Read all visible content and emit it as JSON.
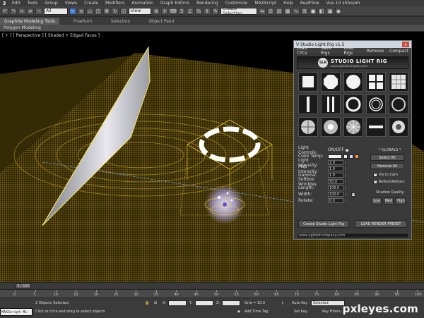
{
  "menubar": {
    "logo": "3",
    "items": [
      "Edit",
      "Tools",
      "Group",
      "Views",
      "Create",
      "Modifiers",
      "Animation",
      "Graph Editors",
      "Rendering",
      "Customize",
      "MAXScript",
      "Help",
      "RealFlow",
      "Vue 10 xStream"
    ]
  },
  "toolbar": {
    "selection_filter": "All",
    "reference_coord": "View",
    "named_selection": "Create Selection"
  },
  "ribbon": {
    "tabs": [
      "Graphite Modeling Tools",
      "Freeform",
      "Selection",
      "Object Paint"
    ],
    "panel": "Polygon Modeling"
  },
  "viewport": {
    "label": "[ + ] [ Perspective ] [ Shaded + Edged Faces ]"
  },
  "rig": {
    "title": "V Studio Light Rig v1.5",
    "close": "x",
    "menu": [
      "Load CYCs",
      "Save Rigs",
      "Load Rigs",
      "Remove",
      "Compact"
    ],
    "banner_logo": "SLR",
    "banner_title": "STUDIO LIGHT RIG",
    "banner_url": "www.agitoldcompany.com",
    "presets": [
      "soft-box-square",
      "soft-box-octagon",
      "soft-box-round",
      "quad-panel",
      "grid-panel",
      "strip-light-single",
      "strip-light-double",
      "ring-light",
      "ring-light-thin",
      "ring-light-soft",
      "spot-light",
      "radial-spot",
      "radial-burst",
      "strip-bar",
      "beauty-dish"
    ],
    "controls": {
      "light_controls": "Light Controls:",
      "on_off": "ON/OFF",
      "color_temp": "Color Temp:",
      "light_intensity": "Light Intensity:",
      "light_intensity_value": "2.0",
      "map_intensity": "Map Intensity:",
      "map_intensity_value": "1.0",
      "gamma": "Gamma:",
      "gamma_value": "1.0",
      "softbox_wrinkles": "Softbox Wrinkles:",
      "softbox_wrinkles_value": "50.0",
      "length": "Length:",
      "length_value": "100.0",
      "width": "Width:",
      "width_value": "100.0",
      "rotate": "Rotate:",
      "rotate_value": "0.0"
    },
    "globals": {
      "label": "* GLOBALS *",
      "select_all": "Select All",
      "remove_all": "Remove All",
      "vis_to_cam": "Vis to Cam",
      "reflect_refract": "Reflect/Refract",
      "shadow_quality": "Shadow Quality:",
      "low": "Low",
      "med": "Med",
      "high": "High"
    },
    "create_button": "Create Studio Light Rig",
    "load_preset_button": "LOAD RENDER PRESET",
    "status_url": "www.agitoldcompany.com",
    "swatch_colors": [
      "#f0f0f0",
      "#d0d8ff",
      "#ff9a3a"
    ]
  },
  "timeslider": {
    "position": "0 / 100",
    "ticks": [
      "0",
      "5",
      "10",
      "15",
      "20",
      "25",
      "30",
      "35",
      "40",
      "45",
      "50",
      "55",
      "60",
      "65",
      "70",
      "75",
      "80",
      "85",
      "90",
      "95",
      "100"
    ]
  },
  "statusbar": {
    "maxscript": "MAXScript Mi:",
    "objects_selected": "2 Objects Selected",
    "hint": "Click or click-and-drag to select objects",
    "x_label": "X:",
    "y_label": "Y:",
    "z_label": "Z:",
    "grid": "Grid = 10.0",
    "add_time_tag": "Add Time Tag",
    "auto_key": "Auto Key",
    "set_key": "Set Key",
    "key_mode": "Selected",
    "key_filters": "Key Filters..."
  },
  "watermark": "pxleyes.com",
  "colors": {
    "grid": "#c9a21c",
    "floor": "#3a2f05",
    "accent": "#3d7ad6",
    "title_bar": "#cfd6e0"
  }
}
